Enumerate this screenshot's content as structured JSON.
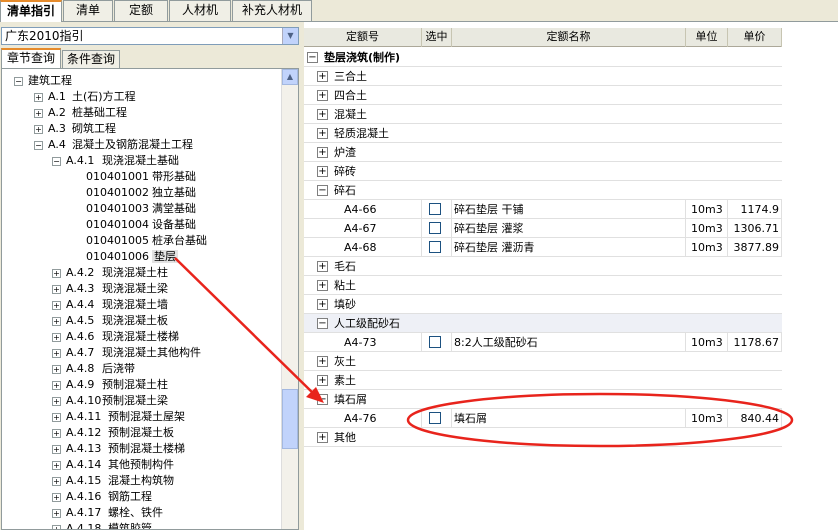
{
  "tabs": [
    "清单指引",
    "清单",
    "定额",
    "人材机",
    "补充人材机"
  ],
  "left": {
    "combo_value": "广东2010指引",
    "sub_tabs": [
      "章节查询",
      "条件查询"
    ],
    "tree": {
      "root": "建筑工程",
      "sections": [
        {
          "code": "A.1",
          "name": "土(石)方工程"
        },
        {
          "code": "A.2",
          "name": "桩基础工程"
        },
        {
          "code": "A.3",
          "name": "砌筑工程"
        },
        {
          "code": "A.4",
          "name": "混凝土及钢筋混凝土工程"
        }
      ],
      "subsection": {
        "code": "A.4.1",
        "name": "现浇混凝土基础"
      },
      "leaves": [
        {
          "code": "010401001",
          "name": "带形基础"
        },
        {
          "code": "010401002",
          "name": "独立基础"
        },
        {
          "code": "010401003",
          "name": "满堂基础"
        },
        {
          "code": "010401004",
          "name": "设备基础"
        },
        {
          "code": "010401005",
          "name": "桩承台基础"
        },
        {
          "code": "010401006",
          "name": "垫层"
        }
      ],
      "more": [
        {
          "code": "A.4.2",
          "name": "现浇混凝土柱"
        },
        {
          "code": "A.4.3",
          "name": "现浇混凝土梁"
        },
        {
          "code": "A.4.4",
          "name": "现浇混凝土墙"
        },
        {
          "code": "A.4.5",
          "name": "现浇混凝土板"
        },
        {
          "code": "A.4.6",
          "name": "现浇混凝土楼梯"
        },
        {
          "code": "A.4.7",
          "name": "现浇混凝土其他构件"
        },
        {
          "code": "A.4.8",
          "name": "后浇带"
        },
        {
          "code": "A.4.9",
          "name": "预制混凝土柱"
        },
        {
          "code": "A.4.10",
          "name": "预制混凝土梁"
        },
        {
          "code": "A.4.11",
          "name": "预制混凝土屋架"
        },
        {
          "code": "A.4.12",
          "name": "预制混凝土板"
        },
        {
          "code": "A.4.13",
          "name": "预制混凝土楼梯"
        },
        {
          "code": "A.4.14",
          "name": "其他预制构件"
        },
        {
          "code": "A.4.15",
          "name": "混凝土构筑物"
        },
        {
          "code": "A.4.16",
          "name": "钢筋工程"
        },
        {
          "code": "A.4.17",
          "name": "螺栓、铁件"
        },
        {
          "code": "A.4.18",
          "name": "模筑胶管"
        }
      ]
    }
  },
  "grid": {
    "headers": [
      "定额号",
      "选中",
      "定额名称",
      "单位",
      "单价"
    ],
    "top_group": "垫层浇筑(制作)",
    "groups_a": [
      "三合土",
      "四合土",
      "混凝土",
      "轻质混凝土",
      "炉渣",
      "碎砖"
    ],
    "group_gravel": "碎石",
    "gravel_items": [
      {
        "code": "A4-66",
        "name": "碎石垫层 干铺",
        "unit": "10m3",
        "price": "1174.9"
      },
      {
        "code": "A4-67",
        "name": "碎石垫层 灌浆",
        "unit": "10m3",
        "price": "1306.71"
      },
      {
        "code": "A4-68",
        "name": "碎石垫层 灌沥青",
        "unit": "10m3",
        "price": "3877.89"
      }
    ],
    "groups_b": [
      "毛石",
      "粘土",
      "填砂"
    ],
    "group_graded": "人工级配砂石",
    "graded_item": {
      "code": "A4-73",
      "name": "8:2人工级配砂石",
      "unit": "10m3",
      "price": "1178.67"
    },
    "groups_c": [
      "灰土",
      "素土"
    ],
    "group_stone": "填石屑",
    "stone_item": {
      "code": "A4-76",
      "name": "填石屑",
      "unit": "10m3",
      "price": "840.44"
    },
    "group_last": "其他"
  },
  "annotation": {
    "color": "#e8241c"
  }
}
